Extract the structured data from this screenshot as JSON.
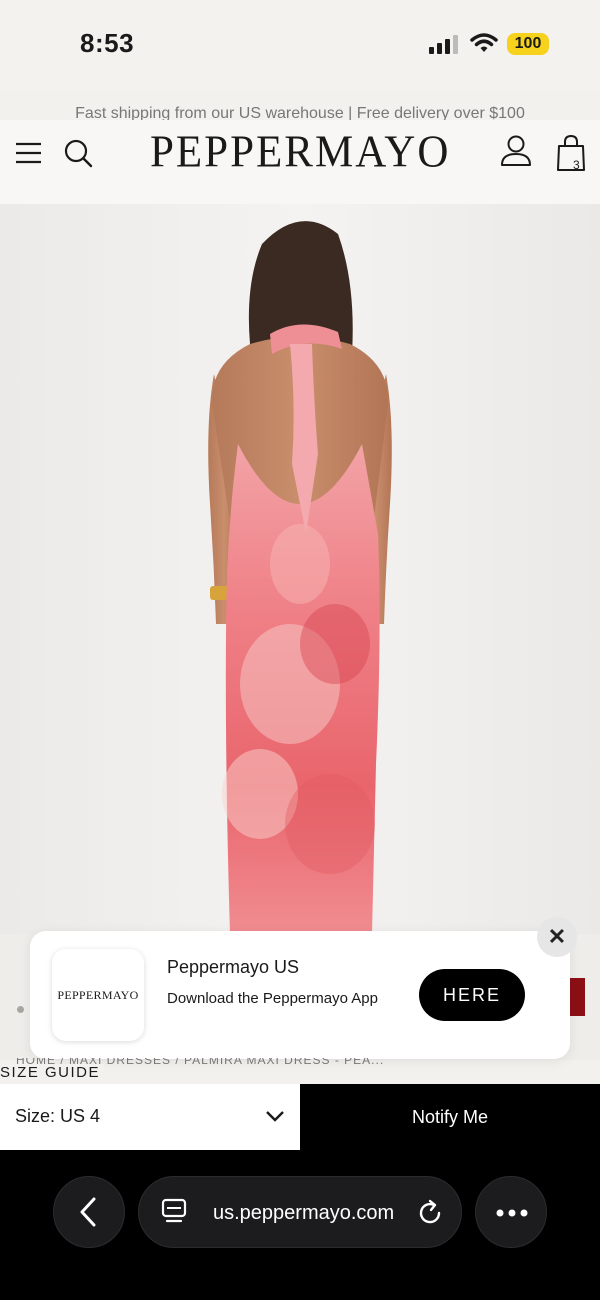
{
  "status_bar": {
    "time": "8:53",
    "battery": "100",
    "signal_icon": "signal-icon",
    "wifi_icon": "wifi-icon"
  },
  "announcement": "Fast shipping from our US warehouse | Free delivery over $100",
  "header": {
    "brand": "PEPPERMAYO",
    "bag_count": "3",
    "icons": [
      "menu-icon",
      "search-icon",
      "account-icon",
      "bag-icon"
    ]
  },
  "product": {
    "image": "model-back-view-pink-floral-halter-maxi-dress",
    "gallery_current": 1
  },
  "app_banner": {
    "logo_text": "PEPPERMAYO",
    "title": "Peppermayo US",
    "description": "Download the Peppermayo App",
    "cta": "HERE",
    "close_icon": "close-icon",
    "close_glyph": "✕"
  },
  "breadcrumb": "HOME / MAXI DRESSES / PALMIRA MAXI DRESS - PEA...",
  "size_guide": "SIZE GUIDE",
  "size_select": {
    "label": "Size: US 4"
  },
  "notify_button": "Notify Me",
  "browser": {
    "url": "us.peppermayo.com"
  },
  "colors": {
    "accent": "#000000",
    "banner_bg": "#ffffff",
    "add_to_bag_red": "#8d0f16",
    "battery": "#f6d21d"
  }
}
